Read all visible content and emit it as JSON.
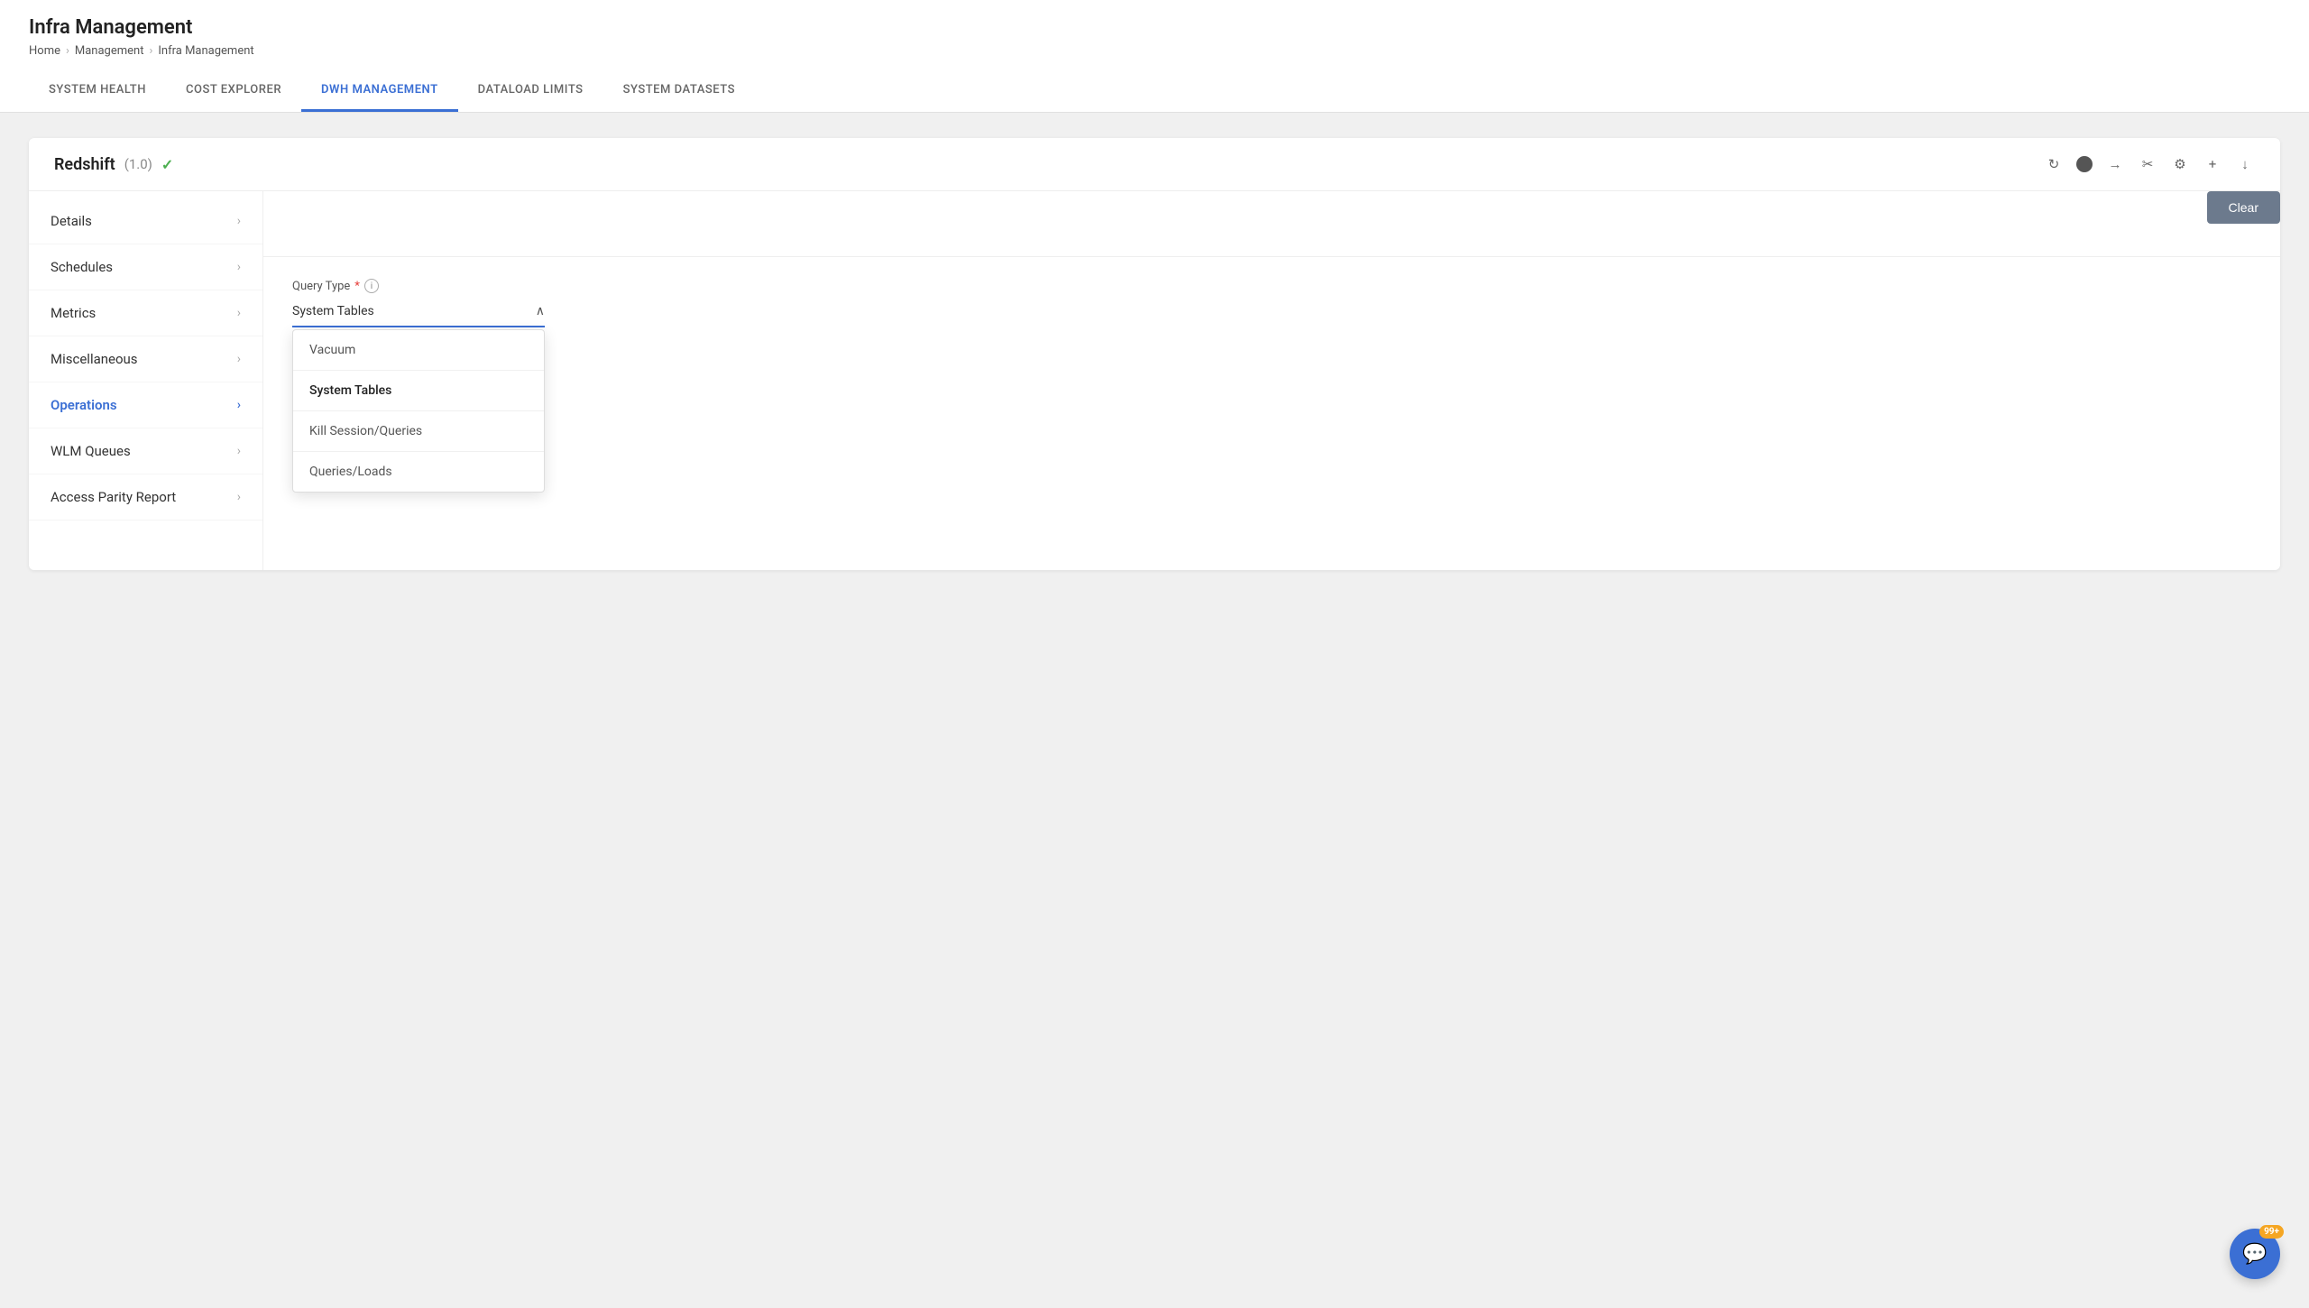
{
  "app": {
    "title": "Infra Management"
  },
  "breadcrumb": {
    "items": [
      "Home",
      "Management",
      "Infra Management"
    ]
  },
  "nav": {
    "tabs": [
      {
        "id": "system-health",
        "label": "SYSTEM HEALTH",
        "active": false
      },
      {
        "id": "cost-explorer",
        "label": "COST EXPLORER",
        "active": false
      },
      {
        "id": "dwh-management",
        "label": "DWH MANAGEMENT",
        "active": true
      },
      {
        "id": "dataload-limits",
        "label": "DATALOAD LIMITS",
        "active": false
      },
      {
        "id": "system-datasets",
        "label": "SYSTEM DATASETS",
        "active": false
      }
    ]
  },
  "card": {
    "title": "Redshift",
    "version": "(1.0)",
    "actions": {
      "refresh": "↻",
      "circle": "",
      "arrow": "→",
      "cut": "✂",
      "person": "♟",
      "plus": "+",
      "download": "↓"
    }
  },
  "sidebar": {
    "items": [
      {
        "id": "details",
        "label": "Details",
        "active": false
      },
      {
        "id": "schedules",
        "label": "Schedules",
        "active": false
      },
      {
        "id": "metrics",
        "label": "Metrics",
        "active": false
      },
      {
        "id": "miscellaneous",
        "label": "Miscellaneous",
        "active": false
      },
      {
        "id": "operations",
        "label": "Operations",
        "active": true
      },
      {
        "id": "wlm-queues",
        "label": "WLM Queues",
        "active": false
      },
      {
        "id": "access-parity-report",
        "label": "Access Parity Report",
        "active": false
      }
    ]
  },
  "operations": {
    "query_type_label": "Query Type",
    "required_star": "*",
    "info_tooltip": "i",
    "dropdown": {
      "selected": "System Tables",
      "options": [
        {
          "id": "vacuum",
          "label": "Vacuum",
          "selected": false
        },
        {
          "id": "system-tables",
          "label": "System Tables",
          "selected": true
        },
        {
          "id": "kill-session",
          "label": "Kill Session/Queries",
          "selected": false
        },
        {
          "id": "queries-loads",
          "label": "Queries/Loads",
          "selected": false
        }
      ]
    },
    "clear_button": "Clear"
  },
  "chat": {
    "badge": "99+",
    "icon": "💬"
  }
}
